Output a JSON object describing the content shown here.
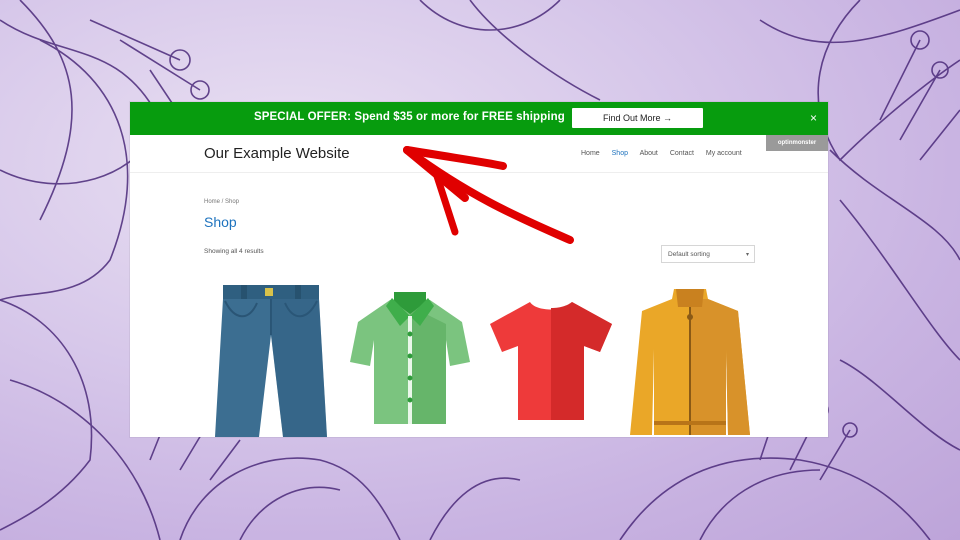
{
  "promo": {
    "text": "SPECIAL OFFER: Spend $35 or more for FREE shipping",
    "cta": "Find Out More →",
    "close": "×"
  },
  "badge": "optinmonster",
  "site": {
    "title": "Our Example Website",
    "nav": [
      "Home",
      "Shop",
      "About",
      "Contact",
      "My account"
    ],
    "active_nav": "Shop"
  },
  "shop": {
    "breadcrumb": "Home / Shop",
    "heading": "Shop",
    "result_count": "Showing all 4 results",
    "sort": "Default sorting"
  },
  "products": [
    {
      "icon": "jeans-icon",
      "color": "#3c6e91"
    },
    {
      "icon": "green-shirt-icon",
      "color": "#5cb85c"
    },
    {
      "icon": "red-tshirt-icon",
      "color": "#e02b2b"
    },
    {
      "icon": "yellow-jacket-icon",
      "color": "#e0a22b"
    }
  ],
  "colors": {
    "promo_bg": "#079c0e",
    "link": "#1e73be",
    "arrow": "#e00000",
    "background": "#c9b4e2"
  }
}
